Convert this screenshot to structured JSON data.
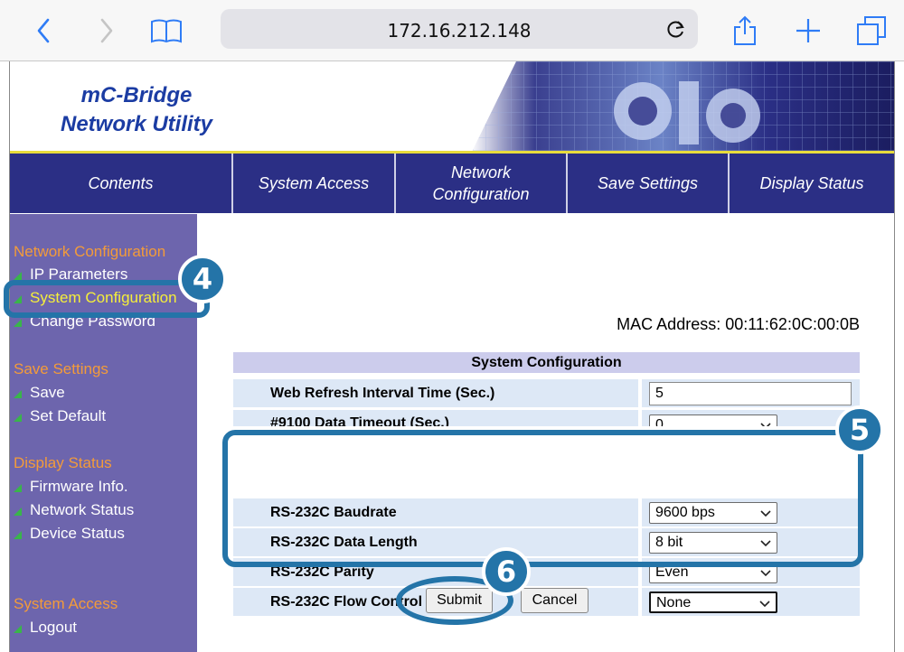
{
  "browser": {
    "url": "172.16.212.148",
    "icons": [
      "back-icon",
      "forward-icon",
      "bookmarks-icon",
      "reload-icon",
      "share-icon",
      "new-tab-icon",
      "tabs-icon"
    ]
  },
  "banner": {
    "title_line1": "mC-Bridge",
    "title_line2": "Network Utility"
  },
  "nav": {
    "items": [
      "Contents",
      "System Access",
      "Network Configuration",
      "Save Settings",
      "Display Status"
    ]
  },
  "sidebar": {
    "sections": [
      {
        "heading": "Network Configuration",
        "items": [
          "IP Parameters",
          "System Configuration",
          "Change Password"
        ]
      },
      {
        "heading": "Save Settings",
        "items": [
          "Save",
          "Set Default"
        ]
      },
      {
        "heading": "Display Status",
        "items": [
          "Firmware Info.",
          "Network Status",
          "Device Status"
        ]
      },
      {
        "heading": "System Access",
        "items": [
          "Logout"
        ]
      }
    ],
    "active_item": "System Configuration"
  },
  "main": {
    "mac_address": "MAC Address: 00:11:62:0C:00:0B",
    "table_title": "System Configuration",
    "rows": [
      {
        "label": "Web Refresh Interval Time (Sec.)",
        "value": "5",
        "kind": "text"
      },
      {
        "label": "#9100 Data Timeout (Sec.)",
        "value": "0",
        "kind": "select"
      },
      {
        "label": "RS-232C Baudrate",
        "value": "9600 bps",
        "kind": "select"
      },
      {
        "label": "RS-232C Data Length",
        "value": "8 bit",
        "kind": "select"
      },
      {
        "label": "RS-232C Parity",
        "value": "Even",
        "kind": "select"
      },
      {
        "label": "RS-232C Flow Control",
        "value": "None",
        "kind": "select"
      }
    ],
    "submit_label": "Submit",
    "cancel_label": "Cancel"
  },
  "callouts": {
    "step4": "4",
    "step5": "5",
    "step6": "6"
  },
  "colors": {
    "accent": "#2f7cf6",
    "nav_bg": "#2b2f85",
    "sidebar_bg": "#6d65ad",
    "callout": "#2474a8",
    "sidebar_heading": "#f39b3a",
    "active_item": "#f5ef3a"
  }
}
